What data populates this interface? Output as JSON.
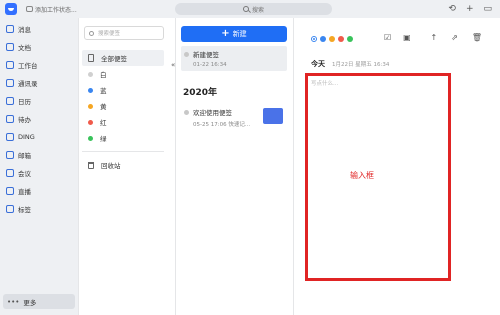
{
  "topbar": {
    "status_text": "添加工作状态...",
    "search_label": "搜索"
  },
  "nav": {
    "items": [
      {
        "label": "消息"
      },
      {
        "label": "文档"
      },
      {
        "label": "工作台"
      },
      {
        "label": "通讯录"
      },
      {
        "label": "日历"
      },
      {
        "label": "待办"
      },
      {
        "label": "DING"
      },
      {
        "label": "邮箱"
      },
      {
        "label": "会议"
      },
      {
        "label": "直播"
      },
      {
        "label": "标签"
      }
    ],
    "more_label": "更多"
  },
  "categories": {
    "search_placeholder": "搜索便签",
    "all_label": "全部便签",
    "items": [
      {
        "label": "白",
        "color": "#d0d0d0"
      },
      {
        "label": "蓝",
        "color": "#3a86f0"
      },
      {
        "label": "黄",
        "color": "#f5a623"
      },
      {
        "label": "红",
        "color": "#f05a4a"
      },
      {
        "label": "绿",
        "color": "#39c35b"
      }
    ],
    "trash_label": "回收站"
  },
  "notes": {
    "new_button_label": "新建",
    "items": [
      {
        "title": "新建便签",
        "meta": "01-22 16:34"
      },
      {
        "title": "欢迎使用便签",
        "meta": "05-25 17:06    快速记..."
      }
    ],
    "year_label": "2020年"
  },
  "editor": {
    "color_dots": [
      "#3a86f0",
      "#3a86f0",
      "#f5a623",
      "#f05a4a",
      "#39c35b"
    ],
    "date_today": "今天",
    "date_text": "1月22日 星期五 16:34",
    "placeholder": "写点什么...",
    "annotation": "输入框"
  }
}
